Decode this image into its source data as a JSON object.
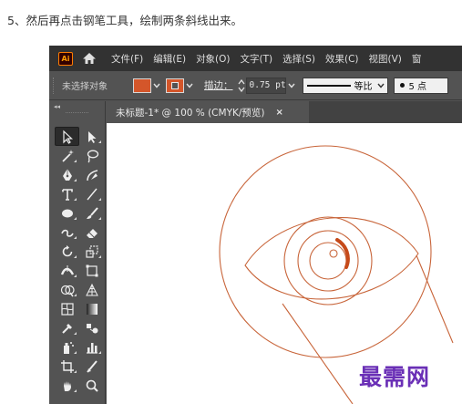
{
  "instruction": "5、然后再点击钢笔工具，绘制两条斜线出来。",
  "app": {
    "logo_text": "Ai",
    "menu": [
      "文件(F)",
      "编辑(E)",
      "对象(O)",
      "文字(T)",
      "选择(S)",
      "效果(C)",
      "视图(V)",
      "窗"
    ],
    "control_bar": {
      "selection_label": "未选择对象",
      "fill_color": "#d4562a",
      "stroke_color": "#d4562a",
      "stroke_label": "描边：",
      "stroke_weight": "0.75 pt",
      "line_style_label": "等比",
      "brush_label": "5 点"
    },
    "document_tab": {
      "title": "未标题-1* @ 100 % (CMYK/预览)",
      "close_glyph": "×"
    },
    "tools": [
      "selection-tool",
      "direct-selection-tool",
      "magic-wand-tool",
      "lasso-tool",
      "pen-tool",
      "curvature-tool",
      "type-tool",
      "line-segment-tool",
      "ellipse-tool",
      "paintbrush-tool",
      "shaper-tool",
      "eraser-tool",
      "rotate-tool",
      "scale-tool",
      "width-tool",
      "free-transform-tool",
      "shape-builder-tool",
      "perspective-grid-tool",
      "mesh-tool",
      "gradient-tool",
      "eyedropper-tool",
      "blend-tool",
      "symbol-sprayer-tool",
      "column-graph-tool",
      "artboard-tool",
      "slice-tool",
      "hand-tool",
      "zoom-tool"
    ],
    "artwork_stroke_color": "#c8653a",
    "artwork_accent_color": "#c64a1a"
  },
  "watermark": "最需网"
}
